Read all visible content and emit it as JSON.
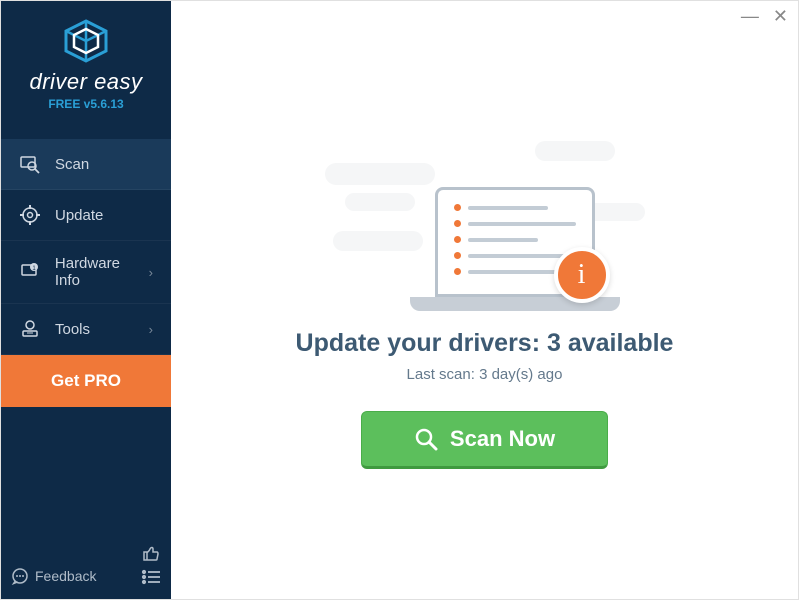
{
  "brand": {
    "name": "driver easy",
    "version_label": "FREE v5.6.13"
  },
  "sidebar": {
    "items": [
      {
        "label": "Scan",
        "has_chevron": false
      },
      {
        "label": "Update",
        "has_chevron": false
      },
      {
        "label": "Hardware Info",
        "has_chevron": true
      },
      {
        "label": "Tools",
        "has_chevron": true
      }
    ],
    "get_pro_label": "Get PRO",
    "feedback_label": "Feedback"
  },
  "main": {
    "headline": "Update your drivers: 3 available",
    "subline": "Last scan: 3 day(s) ago",
    "scan_button_label": "Scan Now",
    "info_badge": "i"
  },
  "window": {
    "minimize": "—",
    "close": "✕"
  }
}
